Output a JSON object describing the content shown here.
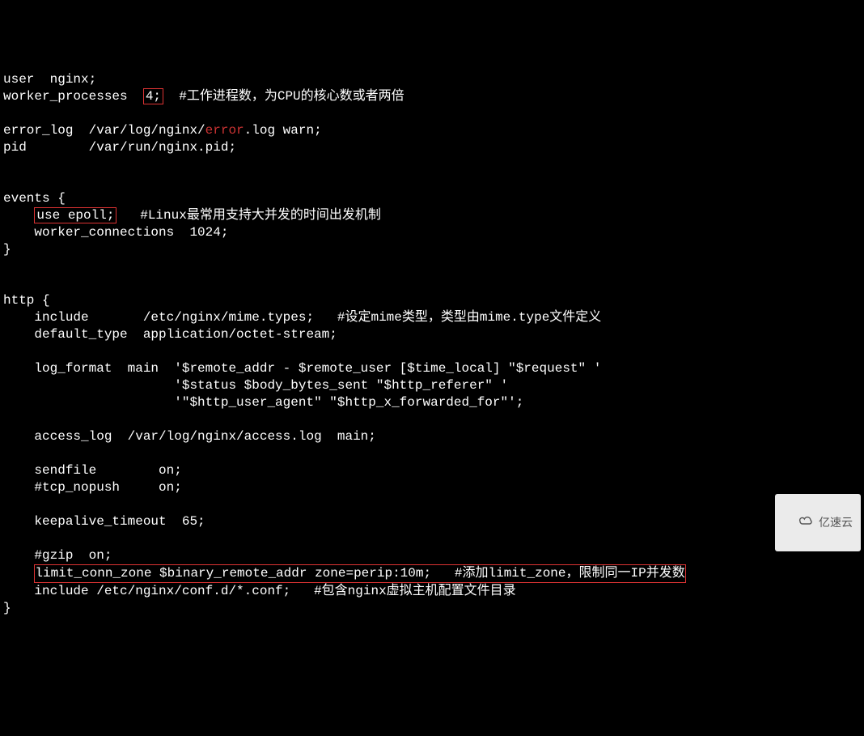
{
  "nginx_config": {
    "line01_pre": "user  nginx;",
    "line02_pre": "worker_processes  ",
    "line02_boxed": "4;",
    "line02_comment": "  #工作进程数，为CPU的核心数或者两倍",
    "blank1": "",
    "line03_pre": "error_log  /var/log/nginx/",
    "line03_error": "error",
    "line03_post": ".log warn;",
    "line04": "pid        /var/run/nginx.pid;",
    "blank2": "",
    "blank3": "",
    "line05": "events {",
    "line06_indent": "    ",
    "line06_boxed": "use epoll;",
    "line06_comment": "   #Linux最常用支持大并发的时间出发机制",
    "line07": "    worker_connections  1024;",
    "line08": "}",
    "blank4": "",
    "blank5": "",
    "line09": "http {",
    "line10": "    include       /etc/nginx/mime.types;   #设定mime类型，类型由mime.type文件定义",
    "line11": "    default_type  application/octet-stream;",
    "blank6": "",
    "line12": "    log_format  main  '$remote_addr - $remote_user [$time_local] \"$request\" '",
    "line13": "                      '$status $body_bytes_sent \"$http_referer\" '",
    "line14": "                      '\"$http_user_agent\" \"$http_x_forwarded_for\"';",
    "blank7": "",
    "line15": "    access_log  /var/log/nginx/access.log  main;",
    "blank8": "",
    "line16": "    sendfile        on;",
    "line17": "    #tcp_nopush     on;",
    "blank9": "",
    "line18": "    keepalive_timeout  65;",
    "blank10": "",
    "line19": "    #gzip  on;",
    "line20_indent": "    ",
    "line20_boxed": "limit_conn_zone $binary_remote_addr zone=perip:10m;   #添加limit_zone，限制同一IP并发数",
    "line21": "    include /etc/nginx/conf.d/*.conf;   #包含nginx虚拟主机配置文件目录",
    "line22": "}"
  },
  "watermark": {
    "label": "亿速云"
  }
}
